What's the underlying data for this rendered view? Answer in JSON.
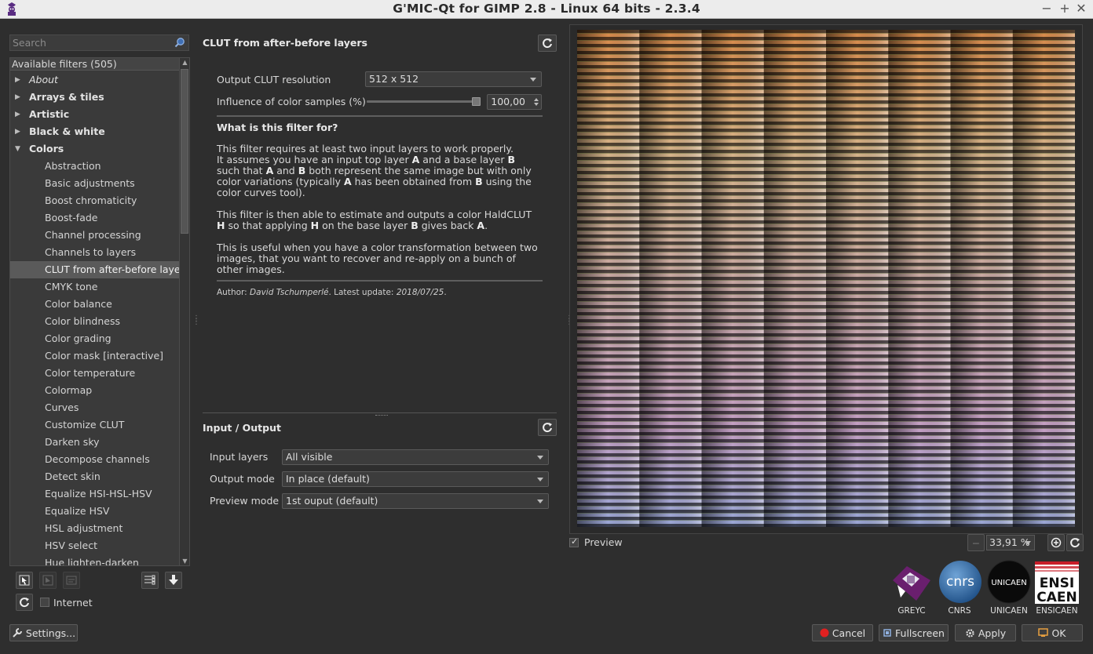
{
  "window": {
    "title": "G'MIC-Qt for GIMP 2.8 - Linux 64 bits - 2.3.4"
  },
  "search": {
    "placeholder": "Search"
  },
  "tree": {
    "header": "Available filters (505)",
    "items": [
      {
        "label": "About",
        "kind": "cat-italic"
      },
      {
        "label": "Arrays & tiles",
        "kind": "cat"
      },
      {
        "label": "Artistic",
        "kind": "cat"
      },
      {
        "label": "Black & white",
        "kind": "cat"
      },
      {
        "label": "Colors",
        "kind": "cat-open"
      },
      {
        "label": "Abstraction",
        "kind": "leaf"
      },
      {
        "label": "Basic adjustments",
        "kind": "leaf"
      },
      {
        "label": "Boost chromaticity",
        "kind": "leaf"
      },
      {
        "label": "Boost-fade",
        "kind": "leaf"
      },
      {
        "label": "Channel processing",
        "kind": "leaf"
      },
      {
        "label": "Channels to layers",
        "kind": "leaf"
      },
      {
        "label": "CLUT from after-before layers",
        "kind": "leaf-selected"
      },
      {
        "label": "CMYK tone",
        "kind": "leaf"
      },
      {
        "label": "Color balance",
        "kind": "leaf"
      },
      {
        "label": "Color blindness",
        "kind": "leaf"
      },
      {
        "label": "Color grading",
        "kind": "leaf"
      },
      {
        "label": "Color mask [interactive]",
        "kind": "leaf"
      },
      {
        "label": "Color temperature",
        "kind": "leaf"
      },
      {
        "label": "Colormap",
        "kind": "leaf"
      },
      {
        "label": "Curves",
        "kind": "leaf"
      },
      {
        "label": "Customize CLUT",
        "kind": "leaf"
      },
      {
        "label": "Darken sky",
        "kind": "leaf"
      },
      {
        "label": "Decompose channels",
        "kind": "leaf"
      },
      {
        "label": "Detect skin",
        "kind": "leaf"
      },
      {
        "label": "Equalize HSI-HSL-HSV",
        "kind": "leaf"
      },
      {
        "label": "Equalize HSV",
        "kind": "leaf"
      },
      {
        "label": "HSL adjustment",
        "kind": "leaf"
      },
      {
        "label": "HSV select",
        "kind": "leaf"
      },
      {
        "label": "Hue lighten-darken",
        "kind": "leaf"
      }
    ]
  },
  "left_bottom": {
    "internet_label": "Internet",
    "settings_label": "Settings..."
  },
  "filter": {
    "title": "CLUT from after-before layers",
    "params": {
      "resolution_label": "Output CLUT resolution",
      "resolution_value": "512 x 512",
      "influence_label": "Influence of color samples (%)",
      "influence_value": "100,00",
      "influence_fraction": 1.0
    },
    "help": {
      "heading": "What is this filter for?",
      "p1_a": "This filter requires at least two input layers to work properly.",
      "p1_b": "It assumes you have an input top layer ",
      "A": "A",
      "p1_c": " and a base layer ",
      "B": "B",
      "p1_d": " such that ",
      "p1_e": " and ",
      "p1_f": " both represent the same image but with only color variations (typically ",
      "p1_g": " has been obtained from ",
      "p1_h": " using the color curves tool).",
      "p2_a": "This filter is then able to estimate and outputs a color HaldCLUT ",
      "H": "H",
      "p2_b": " so that applying ",
      "p2_c": " on the base layer ",
      "p2_d": " gives back ",
      "p2_e": ".",
      "p3": "This is useful when you have a color transformation between two images, that you want to recover and re-apply on a bunch of other images.",
      "author_prefix": "Author: ",
      "author_name": "David Tschumperlé",
      "update_prefix": ". Latest update: ",
      "update_date": "2018/07/25",
      "update_suffix": "."
    }
  },
  "io": {
    "title": "Input / Output",
    "input_layers_label": "Input layers",
    "input_layers_value": "All visible",
    "output_mode_label": "Output mode",
    "output_mode_value": "In place (default)",
    "preview_mode_label": "Preview mode",
    "preview_mode_value": "1st ouput (default)"
  },
  "preview": {
    "checkbox_label": "Preview",
    "zoom_value": "33,91 %"
  },
  "logos": {
    "greyc": "GREYC",
    "cnrs": "CNRS",
    "unicaen": "UNICAEN",
    "ensicaen": "ENSICAEN",
    "cnrs_mark": "cnrs",
    "unicaen_mark": "UNICAEN",
    "ensi_mark_1": "ENSI",
    "ensi_mark_2": "CAEN"
  },
  "buttons": {
    "cancel": "Cancel",
    "fullscreen": "Fullscreen",
    "apply": "Apply",
    "ok": "OK"
  },
  "colors": {
    "background": "#2e2e2e",
    "panel": "#3a3a3a",
    "selected": "#5a5a5a",
    "cancel_red": "#e02020"
  }
}
